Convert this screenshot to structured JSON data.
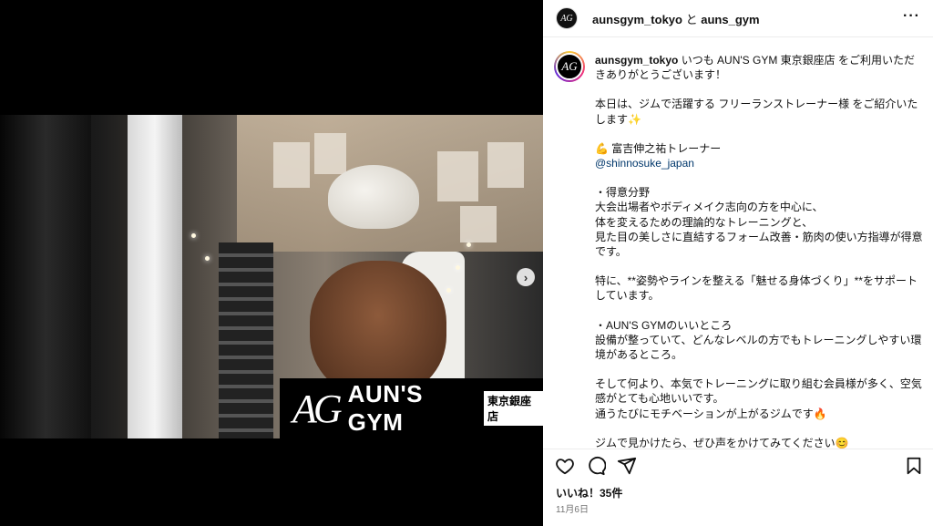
{
  "media": {
    "logo_mark": "AG",
    "logo_text": "AUN'S GYM",
    "logo_branch": "東京銀座店",
    "next_icon": "chevron-right-icon"
  },
  "header": {
    "account_main": "aunsgym_tokyo",
    "conjunction": "と",
    "account_collab": "auns_gym",
    "more_icon": "more-horizontal-icon"
  },
  "caption": {
    "username": "aunsgym_tokyo",
    "intro": " いつも AUN'S GYM 東京銀座店 をご利用いただきありがとうございます！",
    "p2": "本日は、ジムで活躍する フリーランストレーナー様 をご紹介いたします✨",
    "trainer": "💪 富吉伸之祐トレーナー",
    "mention": "@shinnosuke_japan",
    "p4": "・得意分野\n大会出場者やボディメイク志向の方を中心に、\n体を変えるための理論的なトレーニングと、\n見た目の美しさに直結するフォーム改善・筋肉の使い方指導が得意です。",
    "p5": "特に、**姿勢やラインを整える「魅せる身体づくり」**をサポートしています。",
    "p6": "・AUN'S GYMのいいところ\n設備が整っていて、どんなレベルの方でもトレーニングしやすい環境があるところ。",
    "p7": "そして何より、本気でトレーニングに取り組む会員様が多く、空気感がとても心地いいです。\n通うたびにモチベーションが上がるジムです🔥",
    "p8": "ジムで見かけたら、ぜひ声をかけてみてください😊"
  },
  "actions": {
    "like_icon": "heart-icon",
    "comment_icon": "comment-icon",
    "share_icon": "send-icon",
    "save_icon": "bookmark-icon"
  },
  "likes": "いいね！35件",
  "date": "11月6日"
}
